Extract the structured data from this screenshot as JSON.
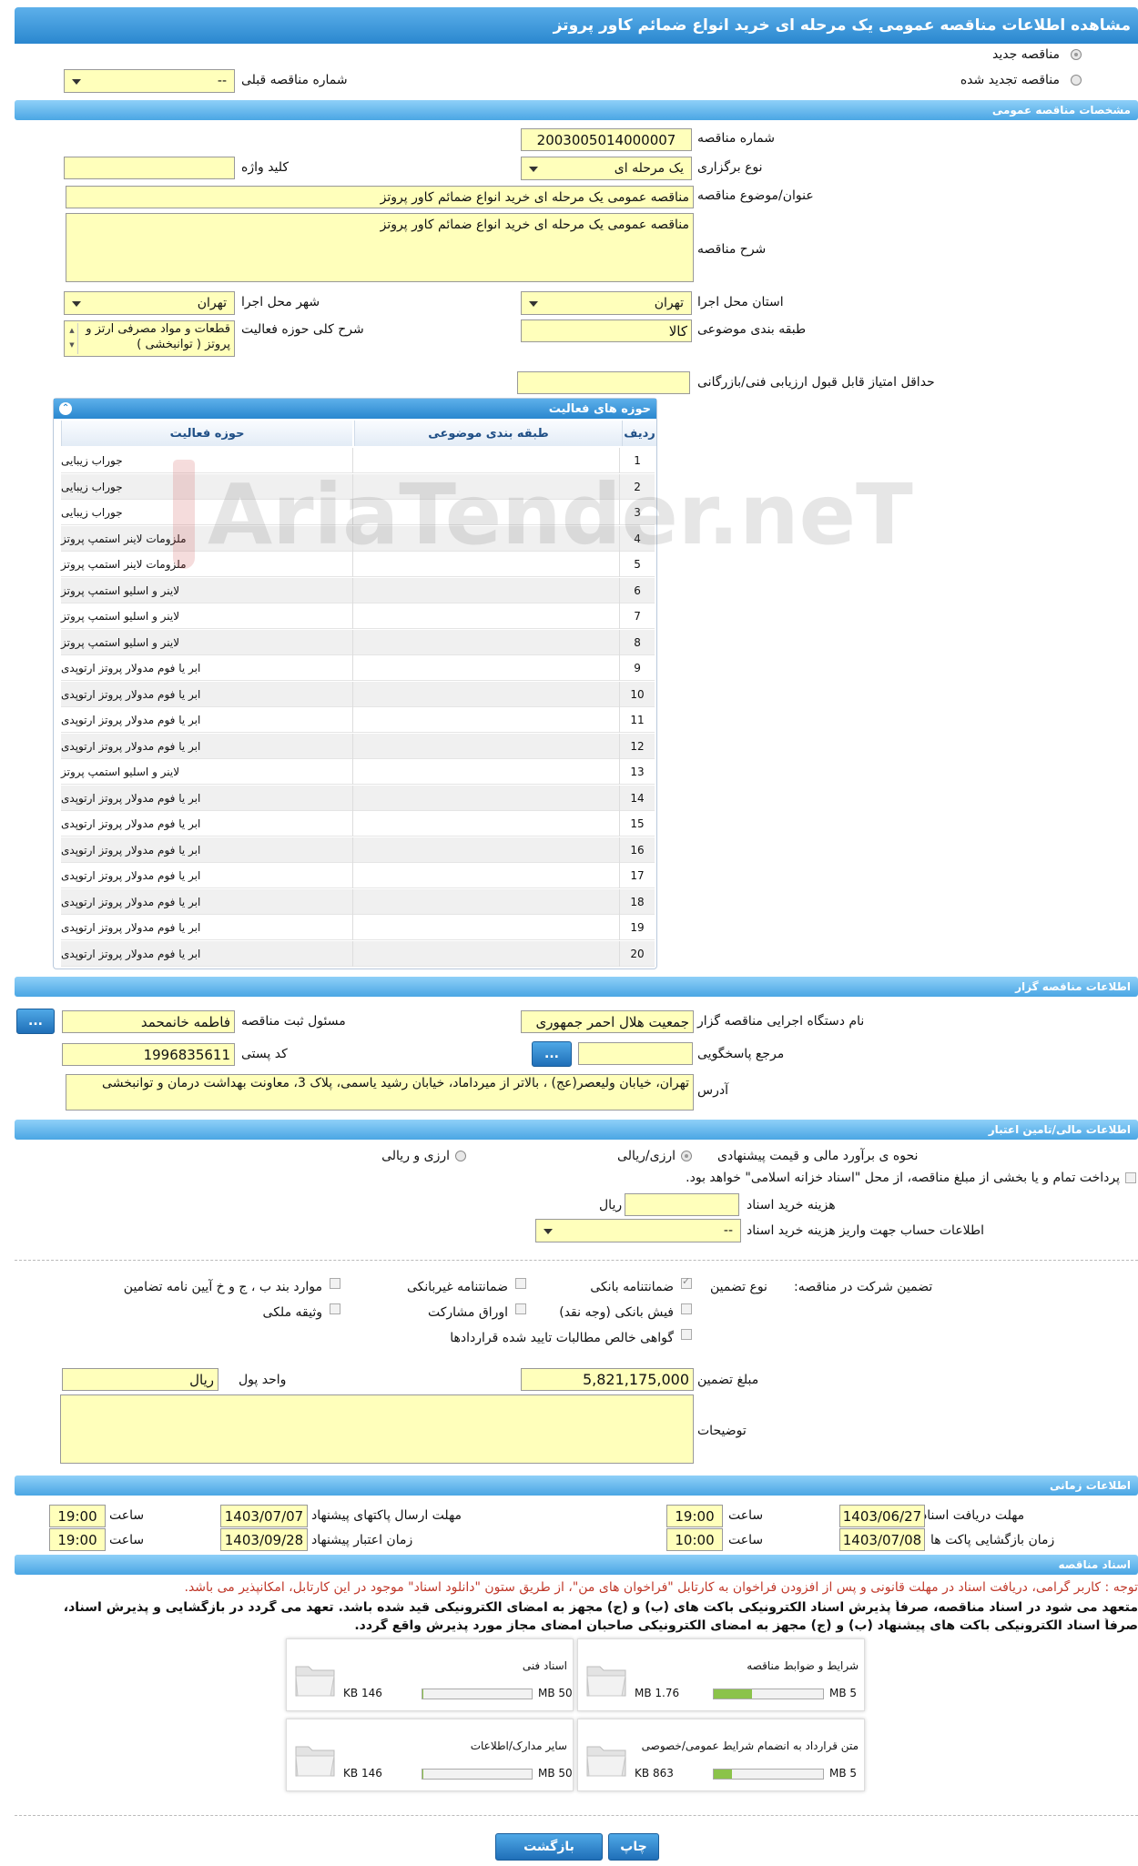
{
  "title": "مشاهده اطلاعات مناقصه عمومی یک مرحله ای خرید انواع ضمائم کاور پروتز",
  "top": {
    "radio_new": "مناقصه جدید",
    "radio_renewed": "مناقصه تجدید شده",
    "prev_number_label": "شماره مناقصه قبلی",
    "prev_number_value": "--"
  },
  "general": {
    "section": "مشخصات مناقصه عمومی",
    "number_label": "شماره مناقصه",
    "number_value": "2003005014000007",
    "type_label": "نوع برگزاری",
    "type_value": "یک مرحله ای",
    "keyword_label": "کلید واژه",
    "keyword_value": "",
    "subject_label": "عنوان/موضوع مناقصه",
    "subject_value": "مناقصه عمومی یک مرحله ای خرید انواع ضمائم کاور پروتز",
    "desc_label": "شرح مناقصه",
    "desc_value": "مناقصه عمومی یک مرحله ای خرید انواع ضمائم کاور پروتز",
    "province_label": "استان محل اجرا",
    "province_value": "تهران",
    "city_label": "شهر محل اجرا",
    "city_value": "تهران",
    "category_label": "طبقه بندی موضوعی",
    "category_value": "کالا",
    "activity_label": "شرح کلی حوزه فعالیت",
    "activity_value": "قطعات و مواد مصرفی ارتز و پروتز ( توانبخشی )",
    "min_score_label": "حداقل امتیاز قابل قبول ارزیابی فنی/بازرگانی",
    "min_score_value": ""
  },
  "grid": {
    "title": "حوزه های فعالیت",
    "col_row": "ردیف",
    "col_category": "طبقه بندی موضوعی",
    "col_activity": "حوزه فعالیت",
    "rows": [
      {
        "n": "1",
        "a": "جوراب زیبایی"
      },
      {
        "n": "2",
        "a": "جوراب زیبایی"
      },
      {
        "n": "3",
        "a": "جوراب زیبایی"
      },
      {
        "n": "4",
        "a": "ملزومات لاینر استمپ پروتز"
      },
      {
        "n": "5",
        "a": "ملزومات لاینر استمپ پروتز"
      },
      {
        "n": "6",
        "a": "لاینر و اسلیو استمپ پروتز"
      },
      {
        "n": "7",
        "a": "لاینر و اسلیو استمپ پروتز"
      },
      {
        "n": "8",
        "a": "لاینر و اسلیو استمپ پروتز"
      },
      {
        "n": "9",
        "a": "ابر یا فوم مدولار پروتز ارتوپدی"
      },
      {
        "n": "10",
        "a": "ابر یا فوم مدولار پروتز ارتوپدی"
      },
      {
        "n": "11",
        "a": "ابر یا فوم مدولار پروتز ارتوپدی"
      },
      {
        "n": "12",
        "a": "ابر یا فوم مدولار پروتز ارتوپدی"
      },
      {
        "n": "13",
        "a": "لاینر و اسلیو استمپ پروتز"
      },
      {
        "n": "14",
        "a": "ابر یا فوم مدولار پروتز ارتوپدی"
      },
      {
        "n": "15",
        "a": "ابر یا فوم مدولار پروتز ارتوپدی"
      },
      {
        "n": "16",
        "a": "ابر یا فوم مدولار پروتز ارتوپدی"
      },
      {
        "n": "17",
        "a": "ابر یا فوم مدولار پروتز ارتوپدی"
      },
      {
        "n": "18",
        "a": "ابر یا فوم مدولار پروتز ارتوپدی"
      },
      {
        "n": "19",
        "a": "ابر یا فوم مدولار پروتز ارتوپدی"
      },
      {
        "n": "20",
        "a": "ابر یا فوم مدولار پروتز ارتوپدی"
      }
    ]
  },
  "watermark": "AriaTender.neT",
  "organizer": {
    "section": "اطلاعات مناقصه گزار",
    "org_label": "نام دستگاه اجرایی مناقصه گزار",
    "org_value": "جمعیت هلال احمر جمهوری",
    "resp_label": "مسئول ثبت مناقصه",
    "resp_value": "فاطمه خانمحمد",
    "ref_label": "مرجع پاسخگویی",
    "ref_value": "",
    "postal_label": "کد پستی",
    "postal_value": "1996835611",
    "address_label": "آدرس",
    "address_value": "تهران، خیابان ولیعصر(عج) ، بالاتر از میرداماد، خیابان رشید یاسمی، پلاک 3، معاونت بهداشت درمان و توانبخشی",
    "dots": "..."
  },
  "finance": {
    "section": "اطلاعات مالی/تامین اعتبار",
    "estimate_label": "نحوه ی برآورد مالی و قیمت پیشنهادی",
    "opt_currency_rial": "ارزی/ریالی",
    "opt_currency_and_rial": "ارزی و ریالی",
    "treasury_note": "پرداخت تمام و یا بخشی از مبلغ مناقصه، از محل \"اسناد خزانه اسلامی\" خواهد بود.",
    "doc_cost_label": "هزینه خرید اسناد",
    "doc_cost_value": "",
    "rial": "ریال",
    "account_label": "اطلاعات حساب جهت واریز هزینه خرید اسناد",
    "account_value": "--",
    "guarantee_label": "تضمین شرکت در مناقصه:",
    "guarantee_type_label": "نوع تضمین",
    "g1": "ضمانتنامه بانکی",
    "g2": "ضمانتنامه غیربانکی",
    "g3": "موارد بند ب ، ج و خ آیین نامه تضامین",
    "g4": "فیش بانکی (وجه نقد)",
    "g5": "اوراق مشارکت",
    "g6": "وثیقه ملکی",
    "g7": "گواهی خالص مطالبات تایید شده قراردادها",
    "amount_label": "مبلغ تضمین",
    "amount_value": "5,821,175,000",
    "currency_label": "واحد پول",
    "currency_value": "ریال",
    "notes_label": "توضیحات",
    "notes_value": ""
  },
  "timing": {
    "section": "اطلاعات زمانی",
    "doc_receive_label": "مهلت دریافت اسناد",
    "doc_receive_date": "1403/06/27",
    "doc_receive_time": "19:00",
    "send_label": "مهلت ارسال پاکتهای پیشنهاد",
    "send_date": "1403/07/07",
    "send_time": "19:00",
    "open_label": "زمان بازگشایی پاکت ها",
    "open_date": "1403/07/08",
    "open_time": "10:00",
    "valid_label": "زمان اعتبار پیشنهاد",
    "valid_date": "1403/09/28",
    "valid_time": "19:00",
    "time_word": "ساعت"
  },
  "docs": {
    "section": "اسناد مناقصه",
    "note_red": "توجه : کاربر گرامی، دریافت اسناد در مهلت قانونی و پس از افزودن فراخوان به کارتابل \"فراخوان های من\"، از طریق ستون \"دانلود اسناد\" موجود در این کارتابل، امکانپذیر می باشد.",
    "note_bold1": "متعهد می شود در اسناد مناقصه، صرفاً پذیرش اسناد الکترونیکی باکت های (ب) و (ج) مجهز به امضای الکترونیکی قید شده باشد. تعهد می گردد در بازگشایی و پذیرش اسناد،",
    "note_bold2": "صرفاً اسناد الکترونیکی باکت های پیشنهاد (ب) و (ج) مجهز به امضای الکترونیکی صاحبان امضای مجاز مورد پذیرش واقع گردد.",
    "items": [
      {
        "name": "شرایط و ضوابط مناقصه",
        "size": "1.76 MB",
        "max": "5 MB",
        "fill": 0.35
      },
      {
        "name": "اسناد فنی",
        "size": "146 KB",
        "max": "50 MB",
        "fill": 0.01
      },
      {
        "name": "متن قرارداد به انضمام شرایط عمومی/خصوصی",
        "size": "863 KB",
        "max": "5 MB",
        "fill": 0.17
      },
      {
        "name": "سایر مدارک/اطلاعات",
        "size": "146 KB",
        "max": "50 MB",
        "fill": 0.01
      }
    ]
  },
  "footer": {
    "print": "چاپ",
    "back": "بازگشت"
  }
}
